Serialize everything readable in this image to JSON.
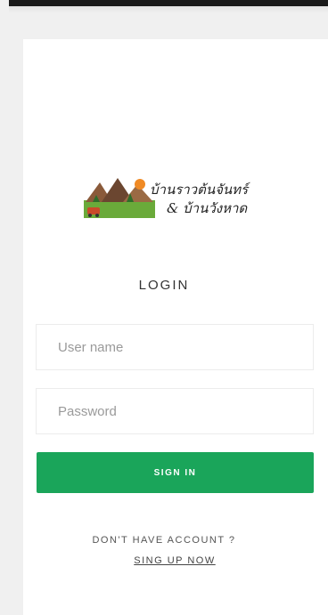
{
  "logo": {
    "line1": "บ้านราวต้นจันทร์",
    "line2": "& บ้านวังหาด"
  },
  "login": {
    "title": "LOGIN",
    "username_placeholder": "User name",
    "password_placeholder": "Password",
    "signin_label": "SIGN IN",
    "no_account_text": "DON'T HAVE ACCOUNT ?",
    "signup_link": "SING UP NOW"
  },
  "colors": {
    "primary": "#1aa55a",
    "topbar": "#1a1a1a"
  }
}
